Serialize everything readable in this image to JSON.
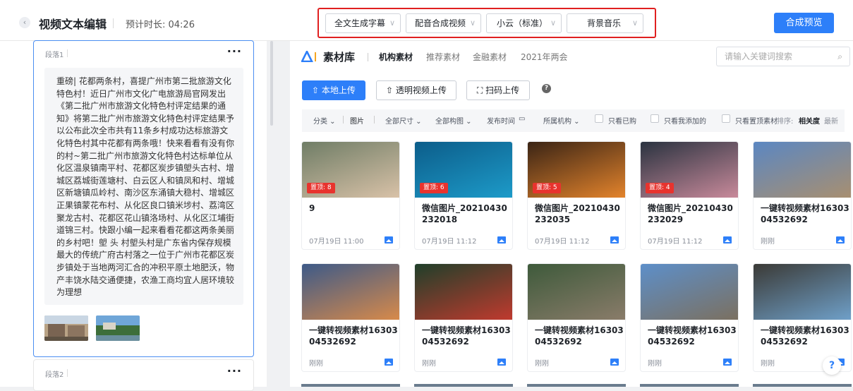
{
  "header": {
    "back_icon": "chevron-left-icon",
    "title": "视频文本编辑",
    "duration": "预计时长: 04:26",
    "dropdowns": [
      "全文生成字幕",
      "配音合成视频",
      "小云（标准）",
      "背景音乐"
    ],
    "preview_button": "合成预览"
  },
  "editor": {
    "segment1_label": "段落1",
    "segment1_text": "重磅| 花都两条村，喜提广州市第二批旅游文化特色村！近日广州市文化广电旅游局官网发出《第二批广州市旅游文化特色村评定结果的通知》将第二批广州市旅游文化特色村评定结果予以公布此次全市共有11条乡村成功达标旅游文化特色村其中花都有两条哦！快来看看有没有你的村~第二批广州市旅游文化特色村达标单位从化区温泉镇南平村、花都区炭步镇塱头古村、增城区荔城街莲塘村、白云区人和镇凤和村、增城区新塘镇瓜岭村、南沙区东涌镇大稳村、增城区正果镇蒙花布村、从化区良口镇米埗村、荔湾区聚龙古村、花都区花山镇洛场村、从化区江埔街道锦三村。快跟小编一起来看看花都这两条美丽的乡村吧！塱 头 村塱头村是广东省内保存规模最大的传统广府古村落之一位于广州市花都区炭步镇处于当地两河汇合的冲积平原土地肥沃，物产丰饶水陆交通便捷，农渔工商均宜人居环境较为理想",
    "segment2_label": "段落2",
    "more_icon": "more-dots-icon"
  },
  "library": {
    "title": "素材库",
    "tabs": [
      "机构素材",
      "推荐素材",
      "金融素材",
      "2021年两会"
    ],
    "search_placeholder": "请输入关键词搜索",
    "upload_local": "本地上传",
    "upload_transparent": "透明视频上传",
    "upload_scan": "扫码上传",
    "filters": {
      "category": "分类 ⌄",
      "image": "图片",
      "size": "全部尺寸 ⌄",
      "composition": "全部构图 ⌄",
      "publish_time": "发布时间",
      "org": "所属机构 ⌄",
      "only_bought": "只看已购",
      "only_added": "只看我添加的",
      "only_pinned": "只看置顶素材",
      "sort_label": "排序:",
      "sort_relevance": "相关度",
      "sort_newest": "最新"
    },
    "items": [
      {
        "title": "9",
        "date": "07月19日 11:00",
        "pin": "置顶: 8",
        "c1": "#6f7d66",
        "c2": "#d9c2a8"
      },
      {
        "title": "微信图片_20210430232018",
        "date": "07月19日 11:12",
        "pin": "置顶: 6",
        "c1": "#0c5d8a",
        "c2": "#1d9bc9"
      },
      {
        "title": "微信图片_20210430232035",
        "date": "07月19日 11:12",
        "pin": "置顶: 5",
        "c1": "#3a2415",
        "c2": "#e4842c"
      },
      {
        "title": "微信图片_20210430232029",
        "date": "07月19日 11:12",
        "pin": "置顶: 4",
        "c1": "#2a3340",
        "c2": "#c98a9b"
      },
      {
        "title": "一键转视频素材1630304532692",
        "date": "刚刚",
        "pin": "",
        "c1": "#5b87c2",
        "c2": "#a88f70"
      },
      {
        "title": "一键转视频素材1630304532692",
        "date": "刚刚",
        "pin": "",
        "c1": "#3d5a88",
        "c2": "#d88a4a"
      },
      {
        "title": "一键转视频素材1630304532692",
        "date": "刚刚",
        "pin": "",
        "c1": "#1f3f2a",
        "c2": "#c13a2e"
      },
      {
        "title": "一键转视频素材1630304532692",
        "date": "刚刚",
        "pin": "",
        "c1": "#3e5a3b",
        "c2": "#8a7c6a"
      },
      {
        "title": "一键转视频素材1630304532692",
        "date": "刚刚",
        "pin": "",
        "c1": "#5d8fc9",
        "c2": "#7b7060"
      },
      {
        "title": "一键转视频素材1630304532692",
        "date": "刚刚",
        "pin": "",
        "c1": "#3b3a36",
        "c2": "#6fa0c9"
      }
    ]
  },
  "help_button": "?",
  "colors": {
    "accent": "#2d7ff9",
    "highlight_border": "#e02020",
    "pin_badge": "#e8332e"
  }
}
